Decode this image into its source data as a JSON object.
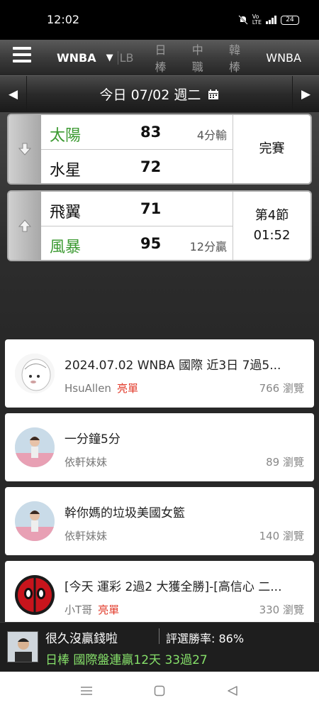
{
  "status_bar": {
    "time": "12:02",
    "battery": "24"
  },
  "nav": {
    "active_league": "WNBA",
    "tab_fragment": "LB",
    "tabs": [
      "日棒",
      "中職",
      "韓棒",
      "WNBA"
    ]
  },
  "date_bar": {
    "label": "今日 07/02 週二"
  },
  "games": [
    {
      "status": "完賽",
      "status_line2": "",
      "teams": [
        {
          "name": "太陽",
          "score": "83",
          "margin": "4分輸"
        },
        {
          "name": "水星",
          "score": "72",
          "margin": ""
        }
      ]
    },
    {
      "status": "第4節",
      "status_line2": "01:52",
      "teams": [
        {
          "name": "飛翼",
          "score": "71",
          "margin": ""
        },
        {
          "name": "風暴",
          "score": "95",
          "margin": "12分贏"
        }
      ]
    }
  ],
  "posts": [
    {
      "title": "2024.07.02 WNBA 國際 近3日 7過5...",
      "author": "HsuAllen",
      "badge": "亮單",
      "views": "766 瀏覽"
    },
    {
      "title": "一分鐘5分",
      "author": "依軒妹妹",
      "badge": "",
      "views": "89 瀏覽"
    },
    {
      "title": "幹你媽的垃圾美國女籃",
      "author": "依軒妹妹",
      "badge": "",
      "views": "140 瀏覽"
    },
    {
      "title": "[今天 運彩 2過2 大獲全勝]-[高信心 二...",
      "author": "小T哥",
      "badge": "亮單",
      "views": "330 瀏覽"
    }
  ],
  "promo": {
    "title": "很久沒贏錢啦",
    "rate": "評選勝率: 86%",
    "line": "日棒 國際盤連贏12天 33過27"
  },
  "colors": {
    "win_team": "#3c9a32",
    "badge": "#e23a2a",
    "promo_line": "#86e06a"
  }
}
